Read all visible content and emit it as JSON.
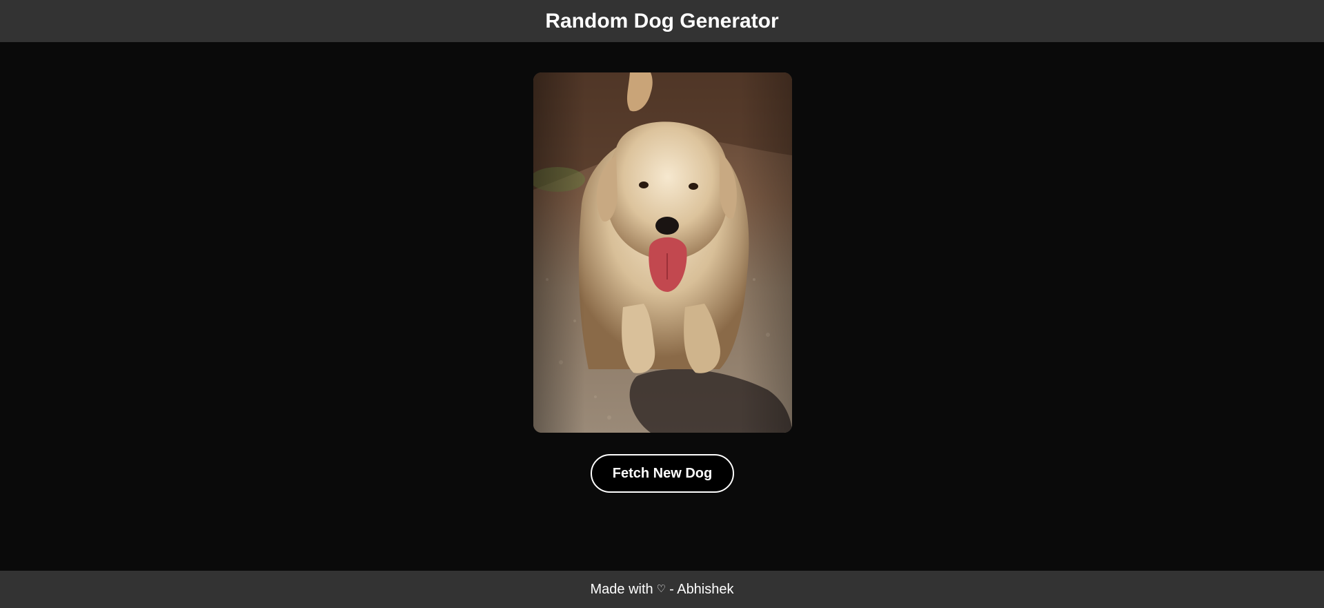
{
  "header": {
    "title": "Random Dog Generator"
  },
  "main": {
    "fetch_button_label": "Fetch New Dog"
  },
  "footer": {
    "made_with": "Made with",
    "heart_icon": "♡",
    "author": "- Abhishek"
  },
  "colors": {
    "header_bg": "#333333",
    "page_bg": "#0a0a0a",
    "button_bg": "#000000",
    "button_border": "#ffffff"
  }
}
